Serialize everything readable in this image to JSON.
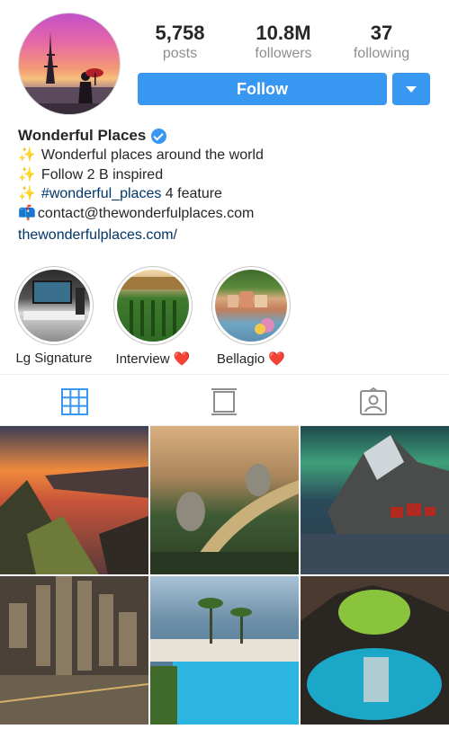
{
  "profile": {
    "name": "Wonderful Places",
    "verified": true,
    "stats": [
      {
        "value": "5,758",
        "label": "posts"
      },
      {
        "value": "10.8M",
        "label": "followers"
      },
      {
        "value": "37",
        "label": "following"
      }
    ],
    "follow_label": "Follow",
    "bio_lines": [
      {
        "icon": "sparkle-icon",
        "text": "Wonderful places around the world"
      },
      {
        "icon": "sparkle-icon",
        "text": "Follow 2 B inspired"
      },
      {
        "icon": "sparkle-icon",
        "hashtag": "#wonderful_places",
        "text": " 4 feature"
      },
      {
        "icon": "mailbox-icon",
        "text": "contact@thewonderfulplaces.com"
      }
    ],
    "website": "thewonderfulplaces.com/"
  },
  "highlights": [
    {
      "label": "Lg Signature",
      "heart": false
    },
    {
      "label": "Interview",
      "heart": true
    },
    {
      "label": "Bellagio",
      "heart": true
    }
  ],
  "tabs": [
    {
      "icon": "grid-icon",
      "active": true
    },
    {
      "icon": "feed-icon",
      "active": false
    },
    {
      "icon": "tagged-icon",
      "active": false
    }
  ],
  "colors": {
    "accent": "#3897f0",
    "active_tab": "#3897f0",
    "inactive_tab": "#8e8e8e"
  }
}
